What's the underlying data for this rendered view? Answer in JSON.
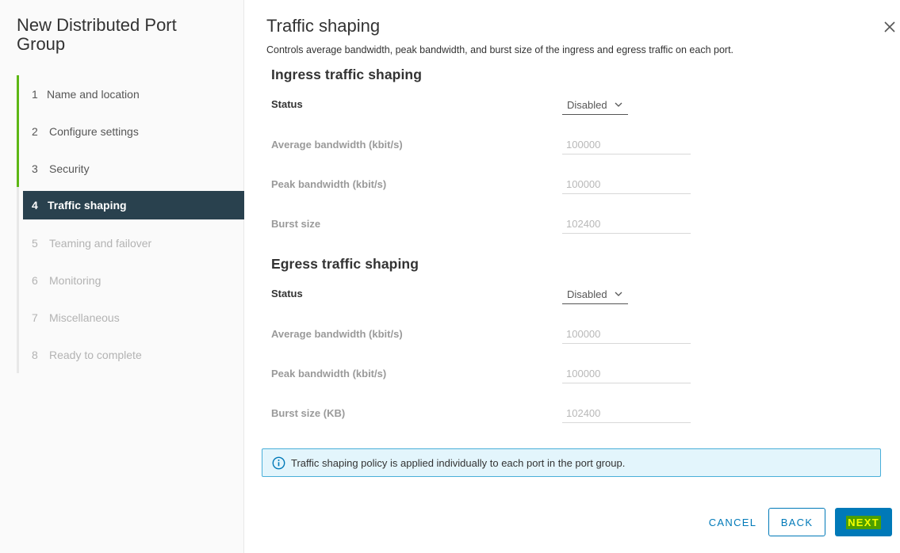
{
  "wizard": {
    "title": "New Distributed Port Group",
    "steps": [
      {
        "num": "1",
        "label": "Name and location"
      },
      {
        "num": "2",
        "label": "Configure settings"
      },
      {
        "num": "3",
        "label": "Security"
      },
      {
        "num": "4",
        "label": "Traffic shaping"
      },
      {
        "num": "5",
        "label": "Teaming and failover"
      },
      {
        "num": "6",
        "label": "Monitoring"
      },
      {
        "num": "7",
        "label": "Miscellaneous"
      },
      {
        "num": "8",
        "label": "Ready to complete"
      }
    ]
  },
  "page": {
    "title": "Traffic shaping",
    "description": "Controls average bandwidth, peak bandwidth, and burst size of the ingress and egress traffic on each port."
  },
  "ingress": {
    "title": "Ingress traffic shaping",
    "status_label": "Status",
    "status_value": "Disabled",
    "avg_label": "Average bandwidth (kbit/s)",
    "avg_value": "100000",
    "peak_label": "Peak bandwidth (kbit/s)",
    "peak_value": "100000",
    "burst_label": "Burst size",
    "burst_value": "102400"
  },
  "egress": {
    "title": "Egress traffic shaping",
    "status_label": "Status",
    "status_value": "Disabled",
    "avg_label": "Average bandwidth (kbit/s)",
    "avg_value": "100000",
    "peak_label": "Peak bandwidth (kbit/s)",
    "peak_value": "100000",
    "burst_label": "Burst size (KB)",
    "burst_value": "102400"
  },
  "info": {
    "icon": "info-icon",
    "text": "Traffic shaping policy is applied individually to each port in the port group."
  },
  "buttons": {
    "cancel": "CANCEL",
    "back": "BACK",
    "next": "NEXT"
  },
  "colors": {
    "accent": "#0079b8",
    "active_step_bg": "#29414e",
    "done_step_bar": "#5eb715",
    "info_bg": "#e3f5fc",
    "info_border": "#49afd9"
  }
}
